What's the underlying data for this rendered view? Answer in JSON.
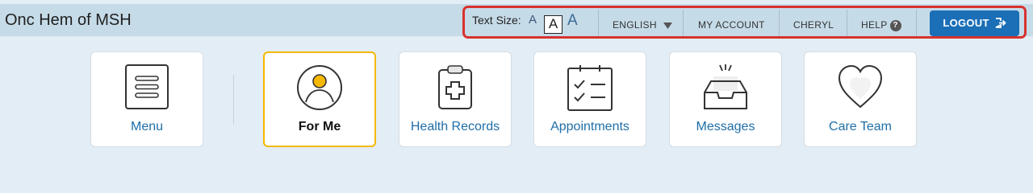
{
  "app": {
    "title": "Onc Hem of MSH"
  },
  "header": {
    "text_size_label": "Text Size:",
    "text_size_small": "A",
    "text_size_medium": "A",
    "text_size_large": "A",
    "language": "ENGLISH",
    "my_account": "MY ACCOUNT",
    "user_name": "CHERYL",
    "help": "HELP",
    "logout": "LOGOUT"
  },
  "nav": {
    "cards": [
      {
        "label": "Menu",
        "icon": "menu-icon",
        "active": false
      },
      {
        "label": "For Me",
        "icon": "person-icon",
        "active": true
      },
      {
        "label": "Health Records",
        "icon": "clipboard-medical-icon",
        "active": false
      },
      {
        "label": "Appointments",
        "icon": "calendar-checklist-icon",
        "active": false
      },
      {
        "label": "Messages",
        "icon": "inbox-icon",
        "active": false
      },
      {
        "label": "Care Team",
        "icon": "heart-icon",
        "active": false
      }
    ]
  },
  "colors": {
    "accent": "#1a6fb7",
    "active_border": "#f5b800",
    "highlight": "#d8322f",
    "header_bg": "#c6dbe8",
    "page_bg": "#e3edf5"
  }
}
